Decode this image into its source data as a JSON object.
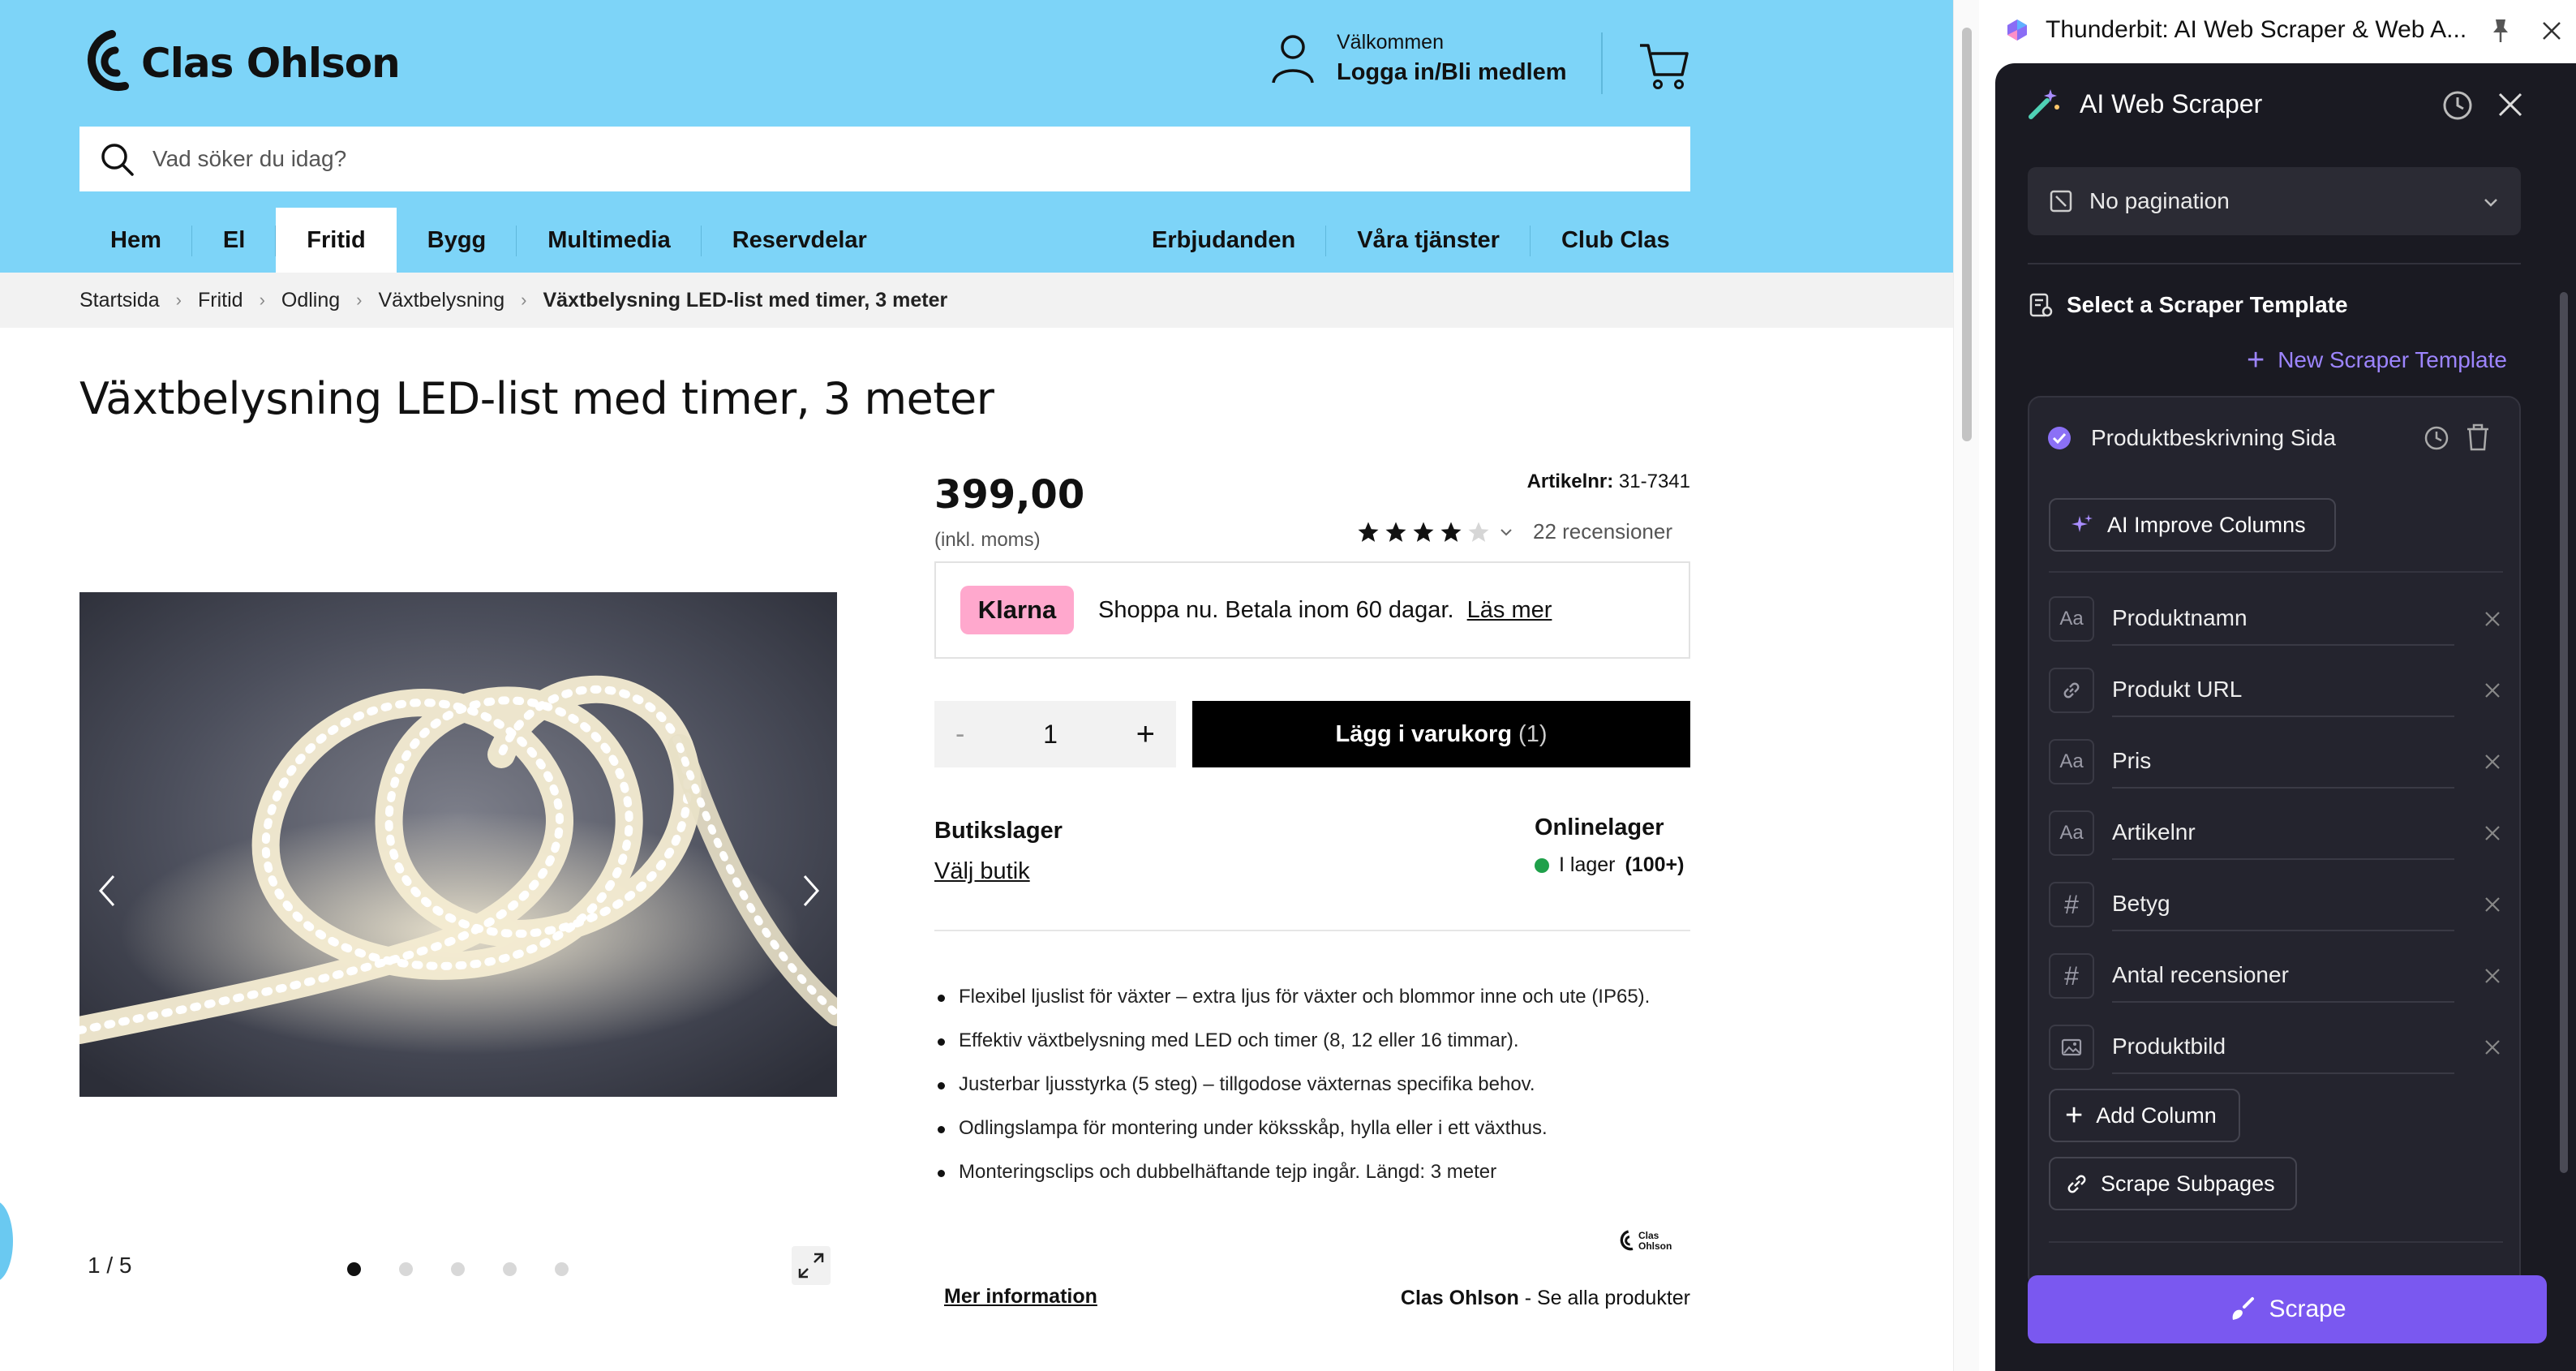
{
  "site": {
    "logo_text": "Clas Ohlson",
    "account": {
      "welcome": "Välkommen",
      "login": "Logga in/Bli medlem"
    },
    "search": {
      "placeholder": "Vad söker du idag?"
    },
    "nav": {
      "left": [
        "Hem",
        "El",
        "Fritid",
        "Bygg",
        "Multimedia",
        "Reservdelar"
      ],
      "active": "Fritid",
      "right": [
        "Erbjudanden",
        "Våra tjänster",
        "Club Clas"
      ]
    },
    "breadcrumb": [
      "Startsida",
      "Fritid",
      "Odling",
      "Växtbelysning",
      "Växtbelysning LED-list med timer, 3 meter"
    ],
    "product": {
      "title": "Växtbelysning LED-list med timer, 3 meter",
      "price": "399,00",
      "price_note": "(inkl. moms)",
      "artnr_label": "Artikelnr:",
      "artnr_value": "31-7341",
      "rating": 4,
      "rating_max": 5,
      "reviews": "22 recensioner",
      "klarna_badge": "Klarna",
      "klarna_text": "Shoppa nu. Betala inom 60 dagar.",
      "klarna_link": "Läs mer",
      "qty_minus": "-",
      "qty_value": "1",
      "qty_plus": "+",
      "add_to_cart": "Lägg i varukorg",
      "add_to_cart_count": "(1)",
      "store_label": "Butikslager",
      "store_link": "Välj butik",
      "online_label": "Onlinelager",
      "stock_text": "I lager",
      "stock_count": "(100+)",
      "features": [
        "Flexibel ljuslist för växter – extra ljus för växter och blommor inne och ute (IP65).",
        "Effektiv växtbelysning med LED och timer (8, 12 eller 16 timmar).",
        "Justerbar ljusstyrka (5 steg) – tillgodose växternas specifika behov.",
        "Odlingslampa för montering under köksskåp, hylla eller i ett växthus.",
        "Monteringsclips och dubbelhäftande tejp ingår. Längd: 3 meter"
      ],
      "gallery_counter": "1  /  5",
      "gallery_total": 5,
      "gallery_current": 1,
      "brand_logo_text": "Clas Ohlson",
      "more_info": "Mer information",
      "brand_name": "Clas Ohlson",
      "see_all": "- Se alla produkter"
    }
  },
  "extension": {
    "tab_title": "Thunderbit: AI Web Scraper & Web A...",
    "panel_title": "AI Web Scraper",
    "pagination": "No pagination",
    "template_header": "Select a Scraper Template",
    "new_template": "New Scraper Template",
    "template_name": "Produktbeskrivning Sida",
    "ai_improve": "AI Improve Columns",
    "columns": [
      {
        "type": "text-icon",
        "type_glyph": "Aa",
        "name": "Produktnamn"
      },
      {
        "type": "link-icon",
        "type_glyph": "🔗",
        "name": "Produkt URL"
      },
      {
        "type": "text-icon",
        "type_glyph": "Aa",
        "name": "Pris"
      },
      {
        "type": "text-icon",
        "type_glyph": "Aa",
        "name": "Artikelnr"
      },
      {
        "type": "number-icon",
        "type_glyph": "#",
        "name": "Betyg"
      },
      {
        "type": "number-icon",
        "type_glyph": "#",
        "name": "Antal recensioner"
      },
      {
        "type": "image-icon",
        "type_glyph": "🖼",
        "name": "Produktbild"
      }
    ],
    "add_column": "Add Column",
    "scrape_subpages": "Scrape Subpages",
    "scrape_button": "Scrape",
    "accent_color": "#7a58f0"
  }
}
